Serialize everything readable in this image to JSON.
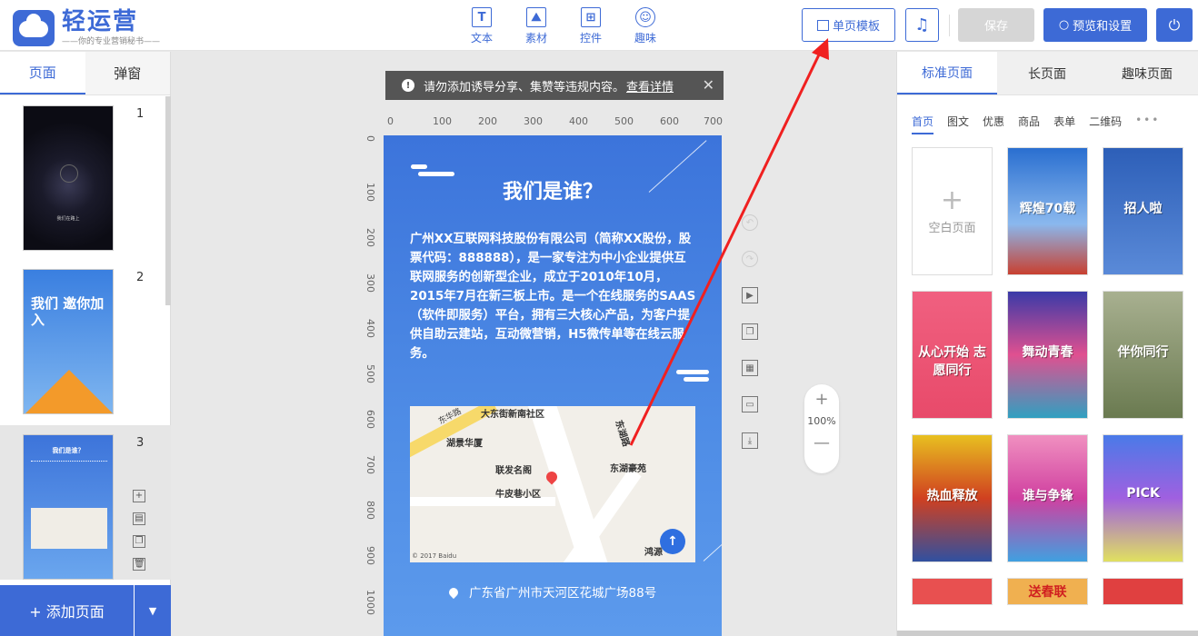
{
  "app": {
    "logo_title": "轻运营",
    "logo_sub": "——你的专业营销秘书——"
  },
  "toolbar": {
    "tools": [
      {
        "label": "文本",
        "icon": "text-icon",
        "glyph": "T"
      },
      {
        "label": "素材",
        "icon": "image-icon",
        "glyph": "⛰"
      },
      {
        "label": "控件",
        "icon": "widgets-icon",
        "glyph": "⊞"
      },
      {
        "label": "趣味",
        "icon": "fun-icon",
        "glyph": "☺"
      }
    ],
    "template_label": "单页模板",
    "music_glyph": "♫",
    "save_label": "保存",
    "preview_label": "预览和设置",
    "power_glyph": "⏻"
  },
  "left": {
    "tabs": [
      "页面",
      "弹窗"
    ],
    "active_tab": "页面",
    "pages": [
      {
        "num": "1",
        "caption": "我们在路上"
      },
      {
        "num": "2",
        "caption": "我们 邀你加入"
      },
      {
        "num": "3",
        "caption": "我们是谁？"
      }
    ],
    "page_actions": [
      "+",
      "▤",
      "❐",
      "🗑"
    ],
    "add_page_label": "+ 添加页面",
    "add_dropdown_glyph": "▼"
  },
  "notice": {
    "text": "请勿添加诱导分享、集赞等违规内容。",
    "link": "查看详情",
    "close": "✕"
  },
  "ruler": {
    "top": [
      "0",
      "100",
      "200",
      "300",
      "400",
      "500",
      "600",
      "700"
    ],
    "left": [
      "0",
      "100",
      "200",
      "300",
      "400",
      "500",
      "600",
      "700",
      "800",
      "900",
      "1000"
    ]
  },
  "phone": {
    "title": "我们是谁？",
    "body": "广州XX互联网科技股份有限公司（简称XX股份，股票代码：888888），是一家专注为中小企业提供互联网服务的创新型企业，成立于2010年10月，2015年7月在新三板上市。是一个在线服务的SAAS（软件即服务）平台，拥有三大核心产品，为客户提供自助云建站，互动微营销，H5微传单等在线云服务。",
    "address": "广东省广州市天河区花城广场88号",
    "map": {
      "labels": [
        "大东街新南社区",
        "东华路",
        "湖景华厦",
        "联发名阁",
        "东湖豪苑",
        "牛皮巷小区",
        "东湖路",
        "鸿源",
        "© 2017 Baidu"
      ],
      "up_glyph": "↑"
    }
  },
  "canvas_tools": [
    "↶",
    "↷",
    "▶",
    "❐",
    "▦",
    "▭",
    "⤓"
  ],
  "zoom": {
    "in": "+",
    "value": "100%",
    "out": "—"
  },
  "right": {
    "tabs": [
      "标准页面",
      "长页面",
      "趣味页面"
    ],
    "active_tab": "标准页面",
    "categories": [
      "首页",
      "图文",
      "优惠",
      "商品",
      "表单",
      "二维码",
      "•••"
    ],
    "active_category": "首页",
    "blank_label": "空白页面",
    "templates": [
      {
        "title": "辉煌70载",
        "color": "#2a6fd0"
      },
      {
        "title": "招人啦",
        "color": "#2d5fb8"
      },
      {
        "title": "从心开始 志愿同行",
        "color": "#e84a6a"
      },
      {
        "title": "舞动青春",
        "color": "#3a3aa8"
      },
      {
        "title": "伴你同行",
        "color": "#8a9a6a"
      },
      {
        "title": "热血释放",
        "color": "#e8c020"
      },
      {
        "title": "谁与争锋",
        "color": "#d040a0"
      },
      {
        "title": "PICK",
        "color": "#4a7ae8"
      },
      {
        "title": "",
        "color": "#e85050"
      },
      {
        "title": "送春联",
        "color": "#e8a040"
      },
      {
        "title": "",
        "color": "#e04040"
      }
    ]
  }
}
